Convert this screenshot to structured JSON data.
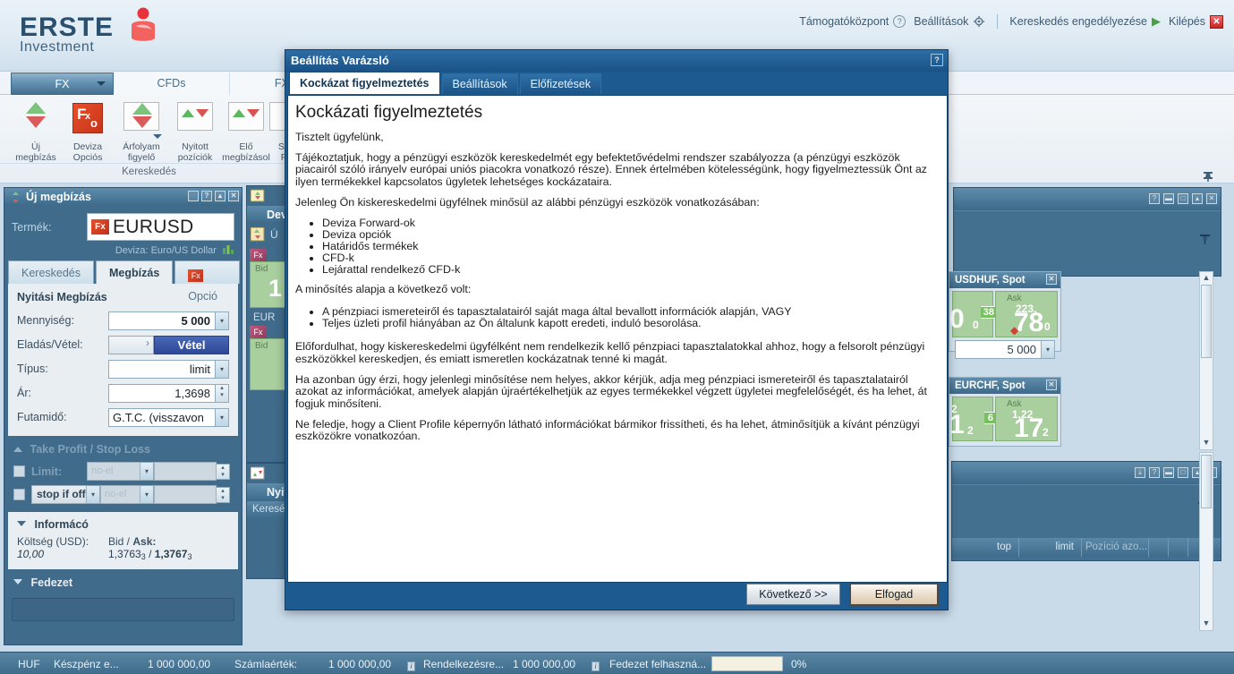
{
  "app": {
    "brand_line1": "ERSTE",
    "brand_line2": "Investment",
    "accent_red": "#e8502a",
    "accent_blue": "#2a5070"
  },
  "header": {
    "links": [
      {
        "label": "Támogatóközpont",
        "icon": "question-circle-icon"
      },
      {
        "label": "Beállítások",
        "icon": "gear-icon"
      },
      {
        "label": "Kereskedés engedélyezése",
        "icon": "play-icon"
      },
      {
        "label": "Kilépés",
        "icon": "close-icon"
      }
    ]
  },
  "main_tabs": [
    {
      "label": "FX",
      "active": true
    },
    {
      "label": "CFDs",
      "active": false
    },
    {
      "label": "FX O",
      "active": false
    }
  ],
  "ribbon": {
    "group_label": "Kereskedés",
    "buttons": [
      {
        "line1": "Új",
        "line2": "megbízás",
        "icon": "new-order-icon"
      },
      {
        "line1": "Deviza",
        "line2": "Opciós",
        "icon": "fx-option-icon"
      },
      {
        "line1": "Árfolyam",
        "line2": "figyelő",
        "icon": "rate-watch-icon"
      },
      {
        "line1": "Nyitott",
        "line2": "pozíciók",
        "icon": "open-positions-icon"
      },
      {
        "line1": "Elő",
        "line2": "megbízásol",
        "icon": "pending-orders-icon"
      },
      {
        "line1": "Sz",
        "line2": "F",
        "icon": "more-icon"
      }
    ]
  },
  "order_panel": {
    "title": "Új megbízás",
    "window_buttons": [
      "restore",
      "help",
      "minimize",
      "close"
    ],
    "product_label": "Termék:",
    "product_value": "EURUSD",
    "product_badge": "Fx",
    "product_sub": "Deviza: Euro/US Dollar",
    "subtabs": [
      {
        "label": "Kereskedés",
        "active": false
      },
      {
        "label": "Megbízás",
        "active": true
      },
      {
        "label": "Opció",
        "active": false,
        "icon": "fx-option-icon"
      }
    ],
    "section_title": "Nyitási Megbízás",
    "fields": [
      {
        "label": "Mennyiség:",
        "value": "5 000",
        "control": "dropdown"
      },
      {
        "label": "Eladás/Vétel:",
        "value": "Vétel",
        "control": "buysell-toggle"
      },
      {
        "label": "Típus:",
        "value": "limit",
        "control": "dropdown"
      },
      {
        "label": "Ár:",
        "value": "1,3698",
        "control": "spinner"
      },
      {
        "label": "Futamidő:",
        "value": "G.T.C. (visszavon",
        "control": "dropdown"
      }
    ],
    "tpsl": {
      "title": "Take Profit / Stop Loss",
      "rows": [
        {
          "checkbox": false,
          "label": "Limit:",
          "placeholder": "no-el",
          "value": ""
        },
        {
          "checkbox": false,
          "label": "stop if offer",
          "placeholder": "no-el",
          "value": ""
        }
      ]
    },
    "info": {
      "title": "Informácó",
      "cost_label": "Költség (USD):",
      "cost_value": "10,00",
      "bidask_label_bid": "Bid /",
      "bidask_label_ask": "Ask:",
      "bid": "1,3763",
      "bid_sub": "3",
      "ask": "1,3767",
      "ask_sub": "3"
    },
    "collateral_title": "Fedezet"
  },
  "mid_panels": {
    "panel1_title": "Devi",
    "panel1_sub": "Ú",
    "tile1_side": "Bid",
    "tile1_val": "1",
    "tile1_pair": "EUR",
    "tile2_side": "Bid",
    "panel2_title": "Nyito",
    "panel2_col": "Keresé"
  },
  "right_panels": {
    "tiles": [
      {
        "title": "USDHUF, Spot",
        "ask_label": "Ask",
        "bid_big": "0",
        "bid_sub": "0",
        "pips": "38",
        "ask_small": "223,",
        "ask_big": "78",
        "ask_sub": "0",
        "qty": "5 000"
      },
      {
        "title": "EURCHF, Spot",
        "ask_label": "Ask",
        "bid_small": "2",
        "bid_big": "1",
        "bid_sub": "2",
        "pips": "6",
        "ask_small": "1,22",
        "ask_big": "17",
        "ask_sub": "2",
        "qty": ""
      }
    ],
    "grid_columns": [
      "top",
      "limit",
      "Pozíció azo..."
    ]
  },
  "wizard": {
    "title": "Beállítás Varázsló",
    "help_icon": "help-icon",
    "tabs": [
      {
        "label": "Kockázat figyelmeztetés",
        "active": true
      },
      {
        "label": "Beállítások",
        "active": false
      },
      {
        "label": "Előfizetések",
        "active": false
      }
    ],
    "heading": "Kockázati figyelmeztetés",
    "paragraphs_1": [
      "Tisztelt ügyfelünk,",
      "Tájékoztatjuk, hogy a pénzügyi eszközök kereskedelmét egy befektetővédelmi rendszer szabályozza (a pénzügyi eszközök piacairól szóló irányelv európai uniós piacokra vonatkozó része). Ennek értelmében kötelességünk, hogy figyelmeztessük Önt az ilyen termékekkel kapcsolatos ügyletek lehetséges kockázataira.",
      "Jelenleg Ön kiskereskedelmi ügyfélnek minősül az alábbi pénzügyi eszközök vonatkozásában:"
    ],
    "list_1": [
      "Deviza Forward-ok",
      "Deviza opciók",
      "Határidős termékek",
      "CFD-k",
      "Lejárattal rendelkező CFD-k"
    ],
    "paragraph_2": "A minősítés alapja a következő volt:",
    "list_2": [
      "A pénzpiaci ismereteiről és tapasztalatairól saját maga által bevallott információk alapján, VAGY",
      "Teljes üzleti profil hiányában az Ön általunk kapott eredeti, induló besorolása."
    ],
    "paragraphs_3": [
      "Előfordulhat, hogy kiskereskedelmi ügyfélként nem rendelkezik kellő pénzpiaci tapasztalatokkal ahhoz, hogy a felsorolt pénzügyi eszközökkel kereskedjen, és emiatt ismeretlen kockázatnak tenné ki magát.",
      "Ha azonban úgy érzi, hogy jelenlegi minősítése nem helyes, akkor kérjük, adja meg pénzpiaci ismereteiről és tapasztalatairól azokat az információkat, amelyek alapján újraértékelhetjük az egyes termékekkel végzett ügyletei megfelelőségét, és ha lehet, át fogjuk minősíteni.",
      "Ne feledje, hogy a Client Profile képernyőn látható információkat bármikor frissítheti, és ha lehet, átminősítjük a kívánt pénzügyi eszközökre vonatkozóan."
    ],
    "buttons": {
      "next": "Következő >>",
      "accept": "Elfogad"
    }
  },
  "status_bar": {
    "currency": "HUF",
    "cash_label": "Készpénz e...",
    "cash_value": "1 000 000,00",
    "account_label": "Számlaérték:",
    "account_value": "1 000 000,00",
    "available_label": "Rendelkezésre...",
    "available_value": "1 000 000,00",
    "margin_label": "Fedezet felhaszná...",
    "margin_percent": "0%"
  }
}
